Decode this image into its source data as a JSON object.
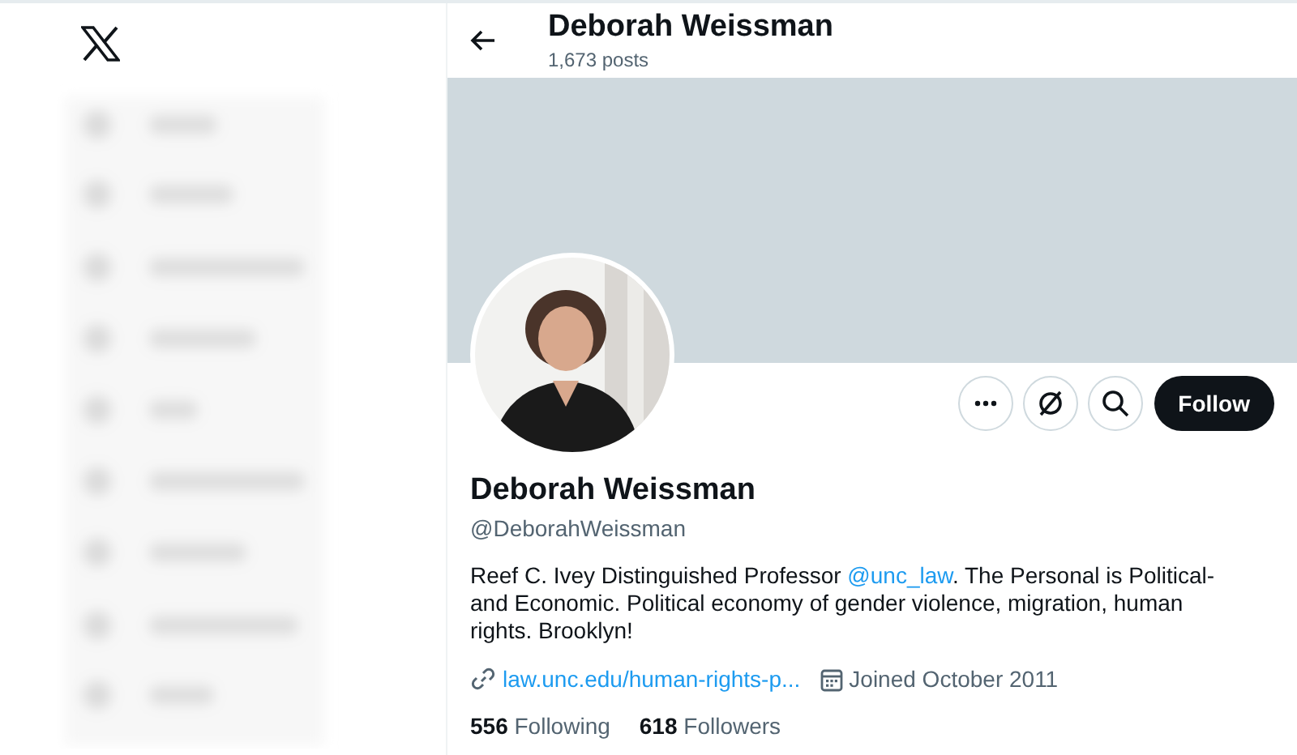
{
  "header": {
    "title": "Deborah Weissman",
    "subtitle": "1,673 posts"
  },
  "actions": [
    {
      "kind": "more"
    },
    {
      "kind": "subscribe"
    },
    {
      "kind": "search"
    },
    {
      "kind": "follow",
      "label": "Follow"
    }
  ],
  "profile": {
    "name": "Deborah Weissman",
    "handle": "@DeborahWeissman"
  },
  "bio": [
    {
      "kind": "text",
      "text": "Reef C. Ivey Distinguished Professor "
    },
    {
      "kind": "mention",
      "text": "@unc_law"
    },
    {
      "kind": "text",
      "text": ". The Personal is Political-and Economic. Political economy of gender violence, migration, human rights. Brooklyn!"
    }
  ],
  "meta": [
    {
      "kind": "link",
      "text": "law.unc.edu/human-rights-p..."
    },
    {
      "kind": "joined",
      "text": "Joined October 2011"
    }
  ],
  "stats": [
    {
      "count": "556",
      "label": "Following"
    },
    {
      "count": "618",
      "label": "Followers"
    }
  ]
}
